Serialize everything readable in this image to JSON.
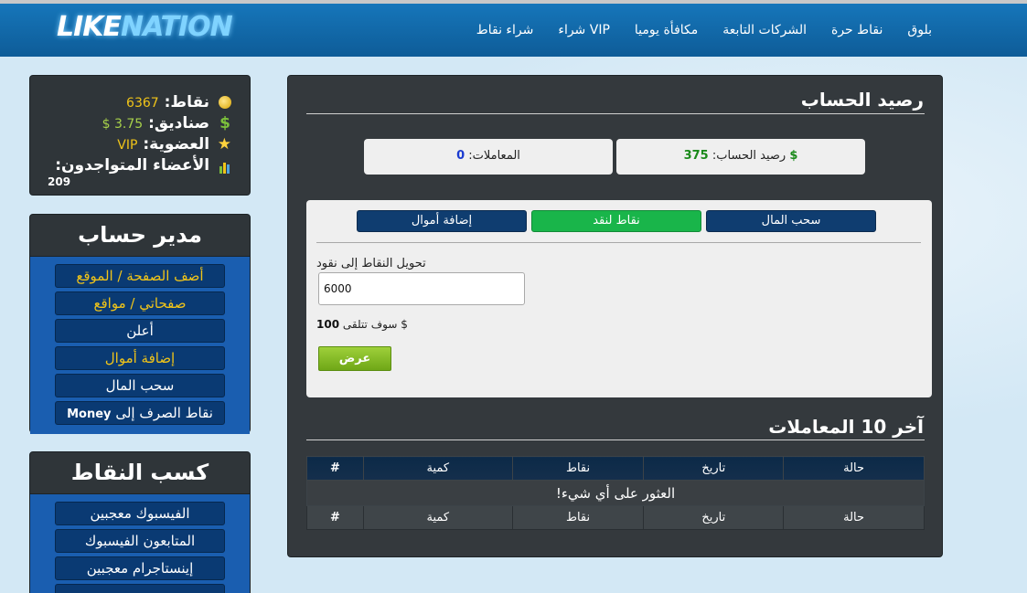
{
  "brand": {
    "part1": "LIKE",
    "part2": "NATION"
  },
  "nav": {
    "items": [
      {
        "label": "بلوق"
      },
      {
        "label": "نقاط حرة"
      },
      {
        "label": "الشركات التابعة"
      },
      {
        "label": "مكافأة يوميا"
      },
      {
        "label": "VIP شراء"
      },
      {
        "label": "شراء نقاط"
      }
    ]
  },
  "stats": {
    "points_label": "نقاط:",
    "points_value": "6367",
    "funds_label": "صناديق:",
    "funds_value": "3.75 $",
    "membership_label": "العضوية:",
    "membership_value": "VIP",
    "online_label": "الأعضاء المتواجدون:",
    "online_value": "209"
  },
  "account_manager": {
    "title": "مدير حساب",
    "items": [
      {
        "label": "أضف الصفحة / الموقع",
        "color": "#f0c419"
      },
      {
        "label": "صفحاتي / مواقع",
        "color": "#f0c419"
      },
      {
        "label": "أعلن",
        "color": "#ffffff"
      },
      {
        "label": "إضافة أموال",
        "color": "#f0c419"
      },
      {
        "label": "سحب المال",
        "color": "#ffffff"
      },
      {
        "label_bold": "Money",
        "label": "نقاط الصرف إلى",
        "color": "#ffffff"
      }
    ]
  },
  "earn_points": {
    "title": "كسب النقاط",
    "items": [
      {
        "label": "الفيسبوك معجبين"
      },
      {
        "label": "المتابعون الفيسبوك"
      },
      {
        "label": "إينستاجرام معجبين"
      }
    ]
  },
  "balance": {
    "title": "رصيد الحساب",
    "account_balance_label": "رصيد الحساب:",
    "account_balance_currency": "$",
    "account_balance_value": "375",
    "transactions_label": "المعاملات:",
    "transactions_value": "0"
  },
  "tabs": {
    "withdraw": "سحب المال",
    "points_to_cash": "نقاط لنقد",
    "add_funds": "إضافة أموال"
  },
  "convert_form": {
    "label": "تحويل النقاط إلى نقود",
    "input_value": "6000",
    "receive_text": "$ سوف تتلقى",
    "receive_value": "100",
    "submit_label": "عرض"
  },
  "transactions": {
    "title_prefix": "آخر",
    "title_count": "10",
    "title_suffix": "المعاملات",
    "columns": [
      "#",
      "كمية",
      "نقاط",
      "تاريخ",
      "حالة"
    ],
    "empty_message": "!العثور على أي شيء"
  },
  "colors": {
    "header": "#1676ba",
    "panel": "#34393d",
    "accent_yellow": "#f0c419",
    "active_tab": "#19b54a",
    "submit": "#8cc22b"
  }
}
